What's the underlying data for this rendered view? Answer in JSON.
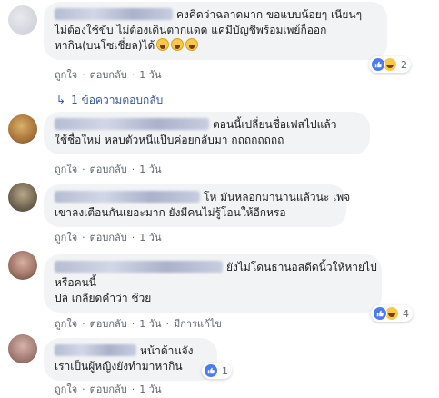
{
  "colors": {
    "link": "#385898",
    "bubble": "#f2f3f5",
    "meta": "#606770",
    "like": "#4c7cf0"
  },
  "actions": {
    "like": "ถูกใจ",
    "reply": "ตอบกลับ",
    "edited": "มีการแก้ไข"
  },
  "comments": [
    {
      "lines": [
        "คงคิดว่าฉลาดมาก ขอแบบน้อยๆ เนียนๆ",
        "ไม่ต้องใช้ขับ ไม่ต้องเดินตากแดด แค่มีบัญชีพร้อมเพย์ก็ออก",
        "หากิน(บนโซเชี่ยล)ได้"
      ],
      "time": "1 วัน",
      "reaction_icons": [
        "like-icon",
        "haha-icon"
      ],
      "reaction_count": "2",
      "replies_label": "1 ข้อความตอบกลับ"
    },
    {
      "lines": [
        "ตอนนี้เปลี่ยนชื่อเฟสไปแล้ว",
        "ใช้ชื่อใหม่ หลบตัวหนีแป๊บค่อยกลับมา ถถถถถถถถ"
      ],
      "time": "1 วัน"
    },
    {
      "lines": [
        "โห มันหลอกมานานแล้วนะ เพจ",
        "เขาลงเตือนกันเยอะมาก ยังมีคนไม่รู้โอนให้อีกหรอ"
      ],
      "time": "1 วัน"
    },
    {
      "lines": [
        "ยังไม่โดนธานอสดีดนิ้วให้หายไป",
        "หรือคนนี้",
        "ปล เกลียดคำว่า ช้วย"
      ],
      "time": "1 วัน",
      "reaction_icons": [
        "like-icon",
        "haha-icon"
      ],
      "reaction_count": "4"
    },
    {
      "lines": [
        "หน้าด้านจัง",
        "เราเป็นผู้หญิงยังทำมาหากิน"
      ],
      "time": "1 วัน",
      "reaction_icons": [
        "like-icon"
      ],
      "reaction_count": "1"
    }
  ]
}
